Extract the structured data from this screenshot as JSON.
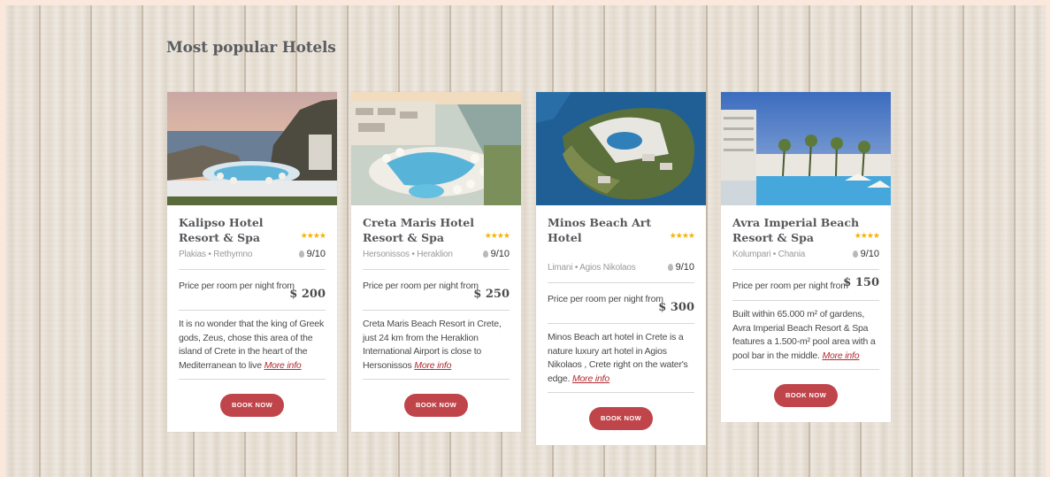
{
  "section_title": "Most popular Hotels",
  "colors": {
    "accent": "#c0454a",
    "stars": "#f4b400",
    "link": "#b02a30"
  },
  "hotels": [
    {
      "name": "Kalipso Hotel Resort & Spa",
      "stars": "★★★★",
      "location": "Plakias • Rethymno",
      "rating": "9/10",
      "price_label": "Price per room per night from",
      "price": "$ 200",
      "description": "It is no wonder that the king of Greek gods, Zeus, chose this area of the island of Crete in the heart of the Mediterranean to live ",
      "more_info": "More info",
      "button": "BOOK NOW"
    },
    {
      "name": "Creta Maris Hotel Resort & Spa",
      "stars": "★★★★",
      "location": "Hersonissos • Heraklion",
      "rating": "9/10",
      "price_label": "Price per room per night from",
      "price": "$ 250",
      "description": "Creta Maris Beach Resort in Crete, just 24 km from the Heraklion International Airport is close to Hersonissos ",
      "more_info": "More info",
      "button": "BOOK NOW"
    },
    {
      "name": "Minos Beach Art Hotel",
      "stars": "★★★★",
      "location": "Limani • Agios Nikolaos",
      "rating": "9/10",
      "price_label": "Price per room per night from",
      "price": "$ 300",
      "description": "Minos Beach art hotel in Crete is a nature luxury art hotel in Agios Nikolaos , Crete right on the water's edge. ",
      "more_info": "More info",
      "button": "BOOK NOW"
    },
    {
      "name": "Avra Imperial Beach Resort & Spa",
      "stars": "★★★★",
      "location": "Kolumpari • Chania",
      "rating": "9/10",
      "price_label": "Price per room per night from",
      "price": "$ 150",
      "description": "Built within 65.000 m² of gardens, Avra Imperial Beach Resort & Spa features a 1.500-m² pool area with a pool bar in the middle. ",
      "more_info": "More info",
      "button": "BOOK NOW"
    }
  ]
}
